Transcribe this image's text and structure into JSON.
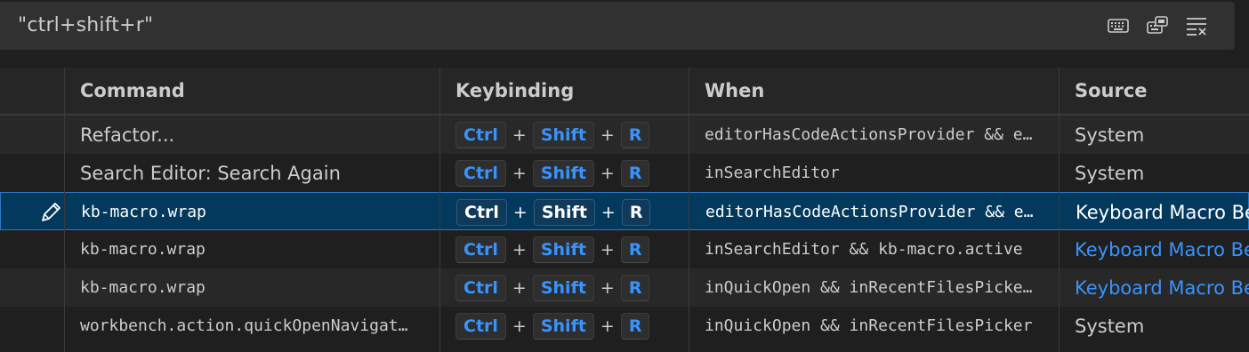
{
  "search": {
    "value": "\"ctrl+shift+r\"",
    "actions": [
      "keyboard-icon",
      "record-keys-icon",
      "clear-filter-icon"
    ]
  },
  "columns": {
    "command": "Command",
    "keybinding": "Keybinding",
    "when": "When",
    "source": "Source"
  },
  "rows": [
    {
      "command": "Refactor...",
      "keys": [
        "Ctrl",
        "Shift",
        "R"
      ],
      "when": "editorHasCodeActionsProvider && e…",
      "source": "System"
    },
    {
      "command": "Search Editor: Search Again",
      "keys": [
        "Ctrl",
        "Shift",
        "R"
      ],
      "when": "inSearchEditor",
      "source": "System"
    },
    {
      "command": "kb-macro.wrap",
      "keys": [
        "Ctrl",
        "Shift",
        "R"
      ],
      "when": "editorHasCodeActionsProvider && e…",
      "source": "Keyboard Macro Be"
    },
    {
      "command": "kb-macro.wrap",
      "keys": [
        "Ctrl",
        "Shift",
        "R"
      ],
      "when": "inSearchEditor && kb-macro.active",
      "source": "Keyboard Macro Be"
    },
    {
      "command": "kb-macro.wrap",
      "keys": [
        "Ctrl",
        "Shift",
        "R"
      ],
      "when": "inQuickOpen && inRecentFilesPicke…",
      "source": "Keyboard Macro Be"
    },
    {
      "command": "workbench.action.quickOpenNavigat…",
      "keys": [
        "Ctrl",
        "Shift",
        "R"
      ],
      "when": "inQuickOpen && inRecentFilesPicker",
      "source": "System"
    }
  ],
  "plus_sign": "+",
  "colors": {
    "accent": "#3794ff",
    "selected_bg": "#04395e",
    "selected_border": "#2b79c2"
  }
}
